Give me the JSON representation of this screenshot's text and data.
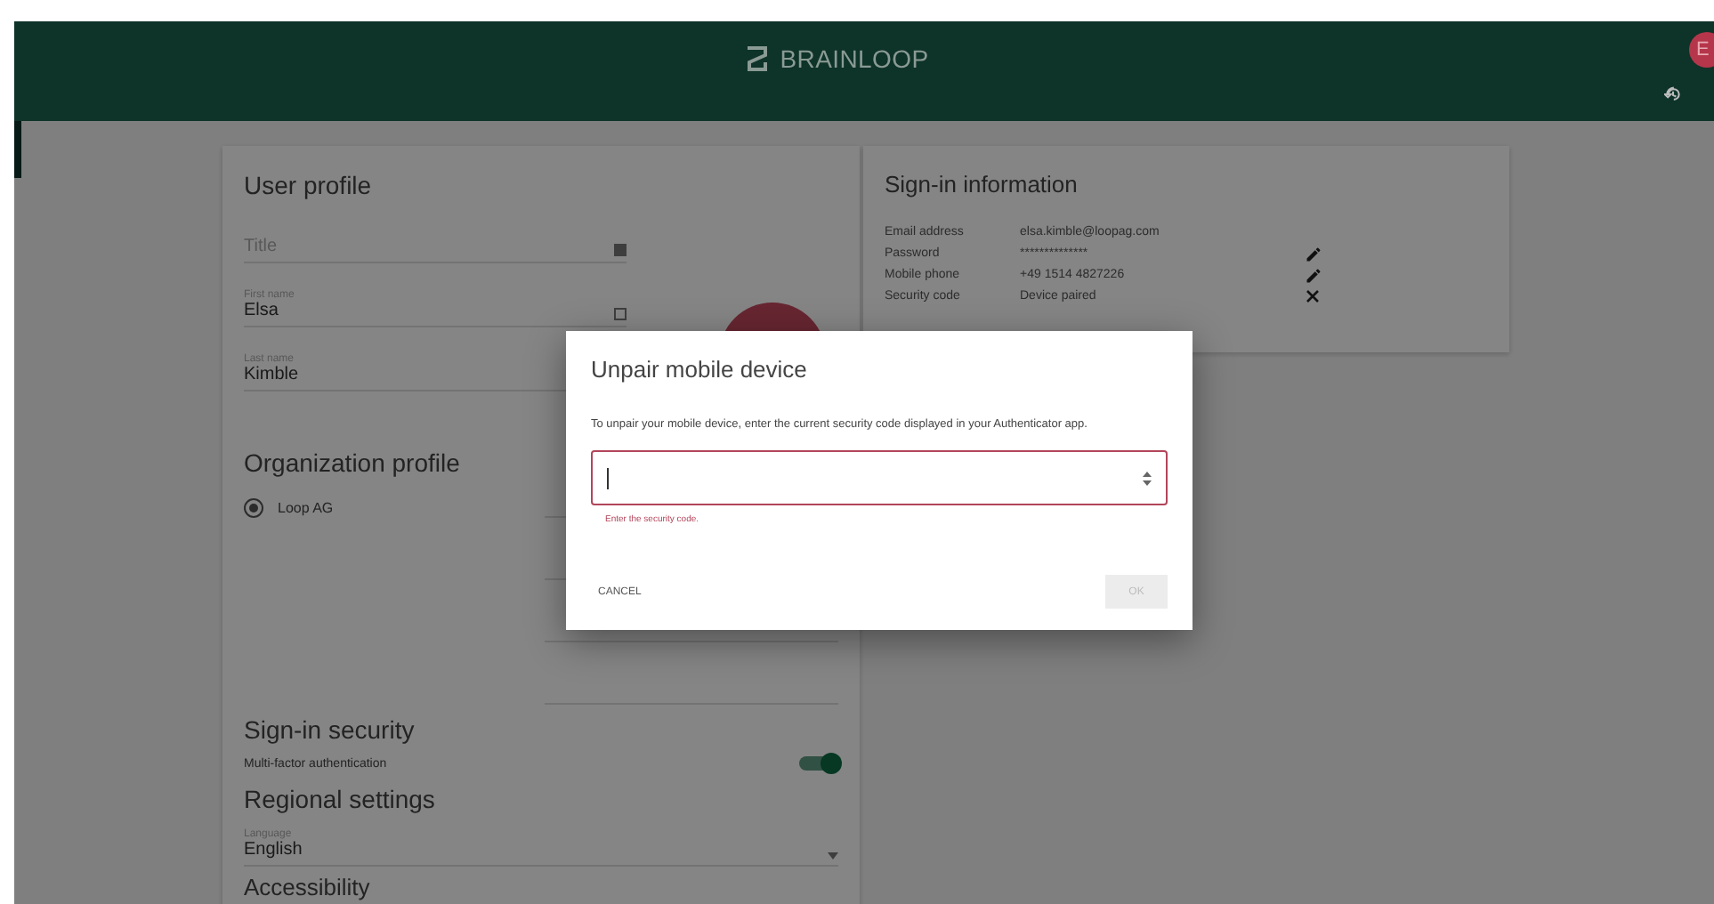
{
  "header": {
    "logo_text": "BRAINLOOP",
    "avatar_initial": "E"
  },
  "user_profile": {
    "title": "User profile",
    "fields": [
      {
        "placeholder": "Title"
      },
      {
        "label": "First name",
        "value": "Elsa"
      },
      {
        "label": "Last name",
        "value": "Kimble"
      }
    ]
  },
  "organization_profile": {
    "title": "Organization profile",
    "options": [
      {
        "label": "Loop AG",
        "selected": true
      }
    ]
  },
  "sign_in_security": {
    "title": "Sign-in security",
    "settings": [
      {
        "label": "Multi-factor authentication",
        "on": true
      }
    ]
  },
  "regional_settings": {
    "title": "Regional settings",
    "language": {
      "label": "Language",
      "value": "English"
    }
  },
  "accessibility": {
    "title": "Accessibility"
  },
  "sign_in_information": {
    "title": "Sign-in information",
    "rows": [
      {
        "kind": "plain",
        "label": "Email address",
        "value": "elsa.kimble@loopag.com"
      },
      {
        "kind": "editable",
        "label": "Password",
        "value": "**************"
      },
      {
        "kind": "editable",
        "label": "Mobile phone",
        "value": "+49 1514 4827226"
      },
      {
        "kind": "removable",
        "label": "Security code",
        "value": "Device paired"
      }
    ]
  },
  "dialog": {
    "title": "Unpair mobile device",
    "message": "To unpair your mobile device, enter the current security code displayed in your Authenticator app.",
    "input": {
      "invalid": true,
      "error": "Enter the security code."
    },
    "buttons": [
      {
        "label": "CANCEL",
        "disabled": false
      },
      {
        "label": "OK",
        "disabled": true
      }
    ]
  }
}
